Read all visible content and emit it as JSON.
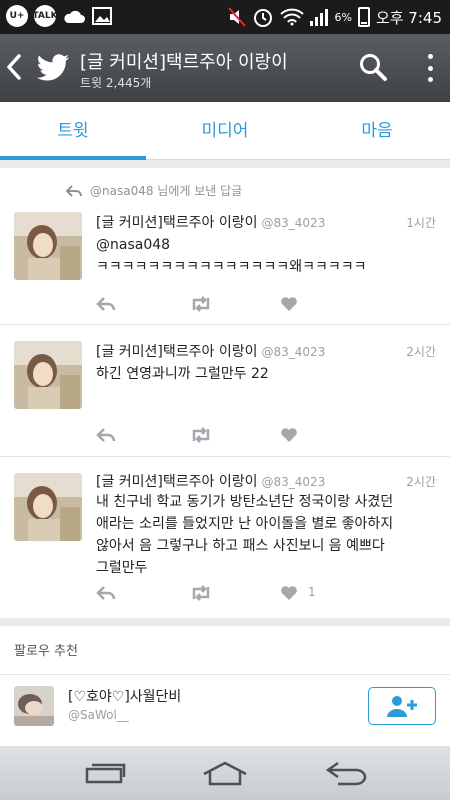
{
  "status_bar": {
    "left_icons": [
      {
        "icon": "u-plus-icon",
        "text": "U+"
      },
      {
        "icon": "kakaotalk-icon",
        "text": "TALK"
      },
      {
        "icon": "cloud-icon",
        "text": ""
      },
      {
        "icon": "gallery-icon",
        "text": ""
      }
    ],
    "battery": "6%",
    "time": "오후 7:45"
  },
  "header": {
    "title": "[글 커미션]택르주아 이랑이",
    "subtitle": "트윗 2,445개"
  },
  "tabs": [
    "트윗",
    "미디어",
    "마음"
  ],
  "active_tab": 0,
  "accent_color": "#2b9cd8",
  "timeline": {
    "reply_context": "@nasa048 님에게 보낸 답글",
    "tweets": [
      {
        "name": "[글 커미션]택르주아 이랑이",
        "handle": "@83_4023",
        "time": "1시간",
        "text_lines": [
          "@nasa048",
          "ㅋㅋㅋㅋㅋㅋㅋㅋㅋㅋㅋㅋㅋㅋㅋ왜ㅋㅋㅋㅋㅋ"
        ],
        "fav_count": ""
      },
      {
        "name": "[글 커미션]택르주아 이랑이",
        "handle": "@83_4023",
        "time": "2시간",
        "text_lines": [
          "하긴 연영과니까 그럴만두 22"
        ],
        "fav_count": ""
      },
      {
        "name": "[글 커미션]택르주아 이랑이",
        "handle": "@83_4023",
        "time": "2시간",
        "text_lines": [
          "내 친구네 학교 동기가 방탄소년단 정국이랑 사겼던",
          "애라는 소리를 들었지만 난 아이돌을 별로 좋아하지",
          "않아서 음 그렇구나 하고 패스 사진보니 음 예쁘다",
          "그럴만두"
        ],
        "fav_count": "1"
      }
    ]
  },
  "follow": {
    "title": "팔로우 추천",
    "name": "[♡호야♡]사월단비",
    "handle": "@SaWol__"
  }
}
